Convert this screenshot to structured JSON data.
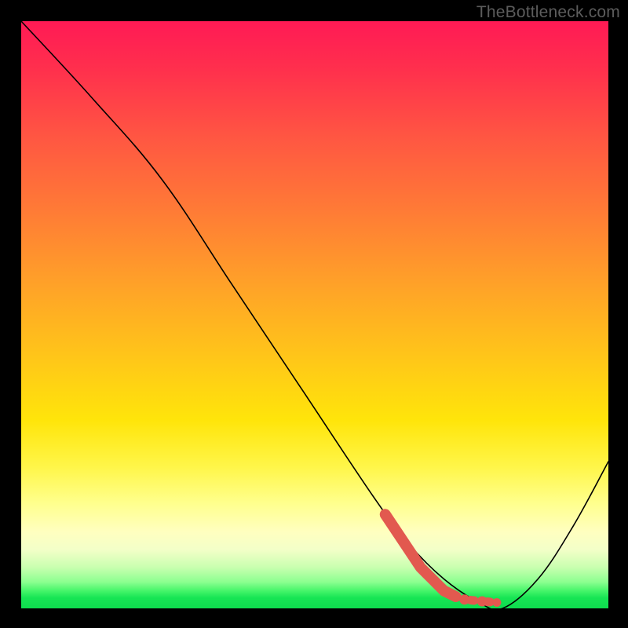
{
  "watermark": "TheBottleneck.com",
  "colors": {
    "marker": "#e2594f",
    "curve": "#000000"
  },
  "chart_data": {
    "type": "line",
    "title": "",
    "xlabel": "",
    "ylabel": "",
    "xlim": [
      0,
      100
    ],
    "ylim": [
      0,
      100
    ],
    "grid": false,
    "legend": false,
    "series": [
      {
        "name": "bottleneck-curve",
        "x": [
          0,
          12,
          24,
          36,
          48,
          60,
          66,
          72,
          78,
          82,
          88,
          94,
          100
        ],
        "y": [
          100,
          87,
          73,
          55,
          37,
          19,
          11,
          5,
          1,
          0,
          5,
          14,
          25
        ]
      }
    ],
    "highlight_segment": {
      "name": "optimal-range-marker",
      "x": [
        62,
        68,
        72,
        74
      ],
      "y": [
        16,
        7,
        3,
        2
      ]
    },
    "highlight_dots": [
      {
        "x": 75.5,
        "y": 1.5
      },
      {
        "x": 78.5,
        "y": 1.2
      },
      {
        "x": 81.0,
        "y": 1.0
      }
    ]
  }
}
